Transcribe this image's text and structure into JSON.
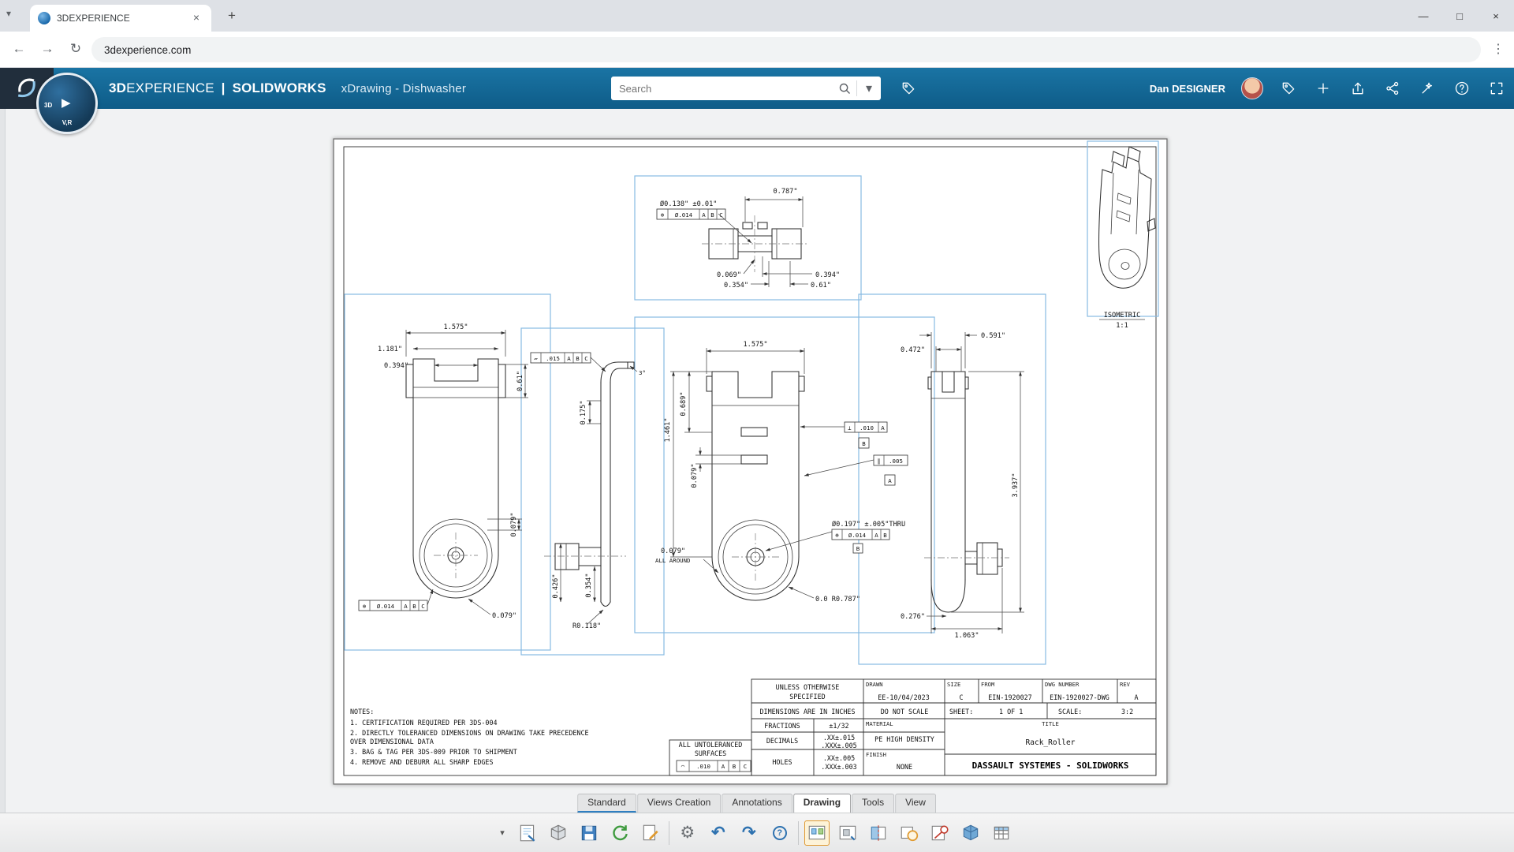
{
  "browser": {
    "tab_title": "3DEXPERIENCE",
    "url": "3dexperience.com",
    "controls": {
      "tab_search": "▾",
      "close_tab": "×",
      "new_tab": "+",
      "minimize": "—",
      "maximize": "□",
      "close": "×"
    },
    "nav": {
      "back": "←",
      "forward": "→",
      "reload": "↻",
      "menu": "⋮"
    }
  },
  "header": {
    "brand_3d": "3D",
    "brand_experience": "EXPERIENCE",
    "brand_divider": "|",
    "brand_app": "SOLIDWORKS",
    "doc_title": "xDrawing - Dishwasher",
    "search_placeholder": "Search",
    "search_chevron": "▾",
    "user_name": "Dan DESIGNER",
    "icon_names": [
      "search-icon",
      "search-dropdown-chevron",
      "bookmark-tag-icon",
      "tag-icon",
      "add-icon",
      "share-icon",
      "collaboration-icon",
      "assistant-icon",
      "help-icon",
      "fullscreen-icon"
    ]
  },
  "compass": {
    "top": "3D",
    "play": "▶",
    "bottom": "V,R"
  },
  "ribbon": {
    "tabs": [
      "Standard",
      "Views Creation",
      "Annotations",
      "Drawing",
      "Tools",
      "View"
    ],
    "active_tab": "Drawing"
  },
  "toolbar": {
    "chevron": "▾",
    "gear": "⚙",
    "undo": "↶",
    "redo": "↷",
    "help": "?",
    "icon_names": [
      "overflow-chevron",
      "drawing-sheet-icon",
      "view-orientation-icon",
      "save-icon",
      "update-icon",
      "sheet-format-icon",
      "options-gear-icon",
      "undo-icon",
      "redo-icon",
      "help-icon",
      "standard-view-tool-icon",
      "model-view-icon",
      "projected-view-icon",
      "section-view-icon",
      "annotation-note-icon",
      "isometric-cube-icon",
      "bom-table-icon"
    ]
  },
  "sheet": {
    "iso": {
      "label": "ISOMETRIC",
      "scale": "1:1"
    },
    "notes": {
      "title": "NOTES:",
      "lines": [
        "1. CERTIFICATION REQUIRED PER 3DS-004",
        "2. DIRECTLY TOLERANCED DIMENSIONS ON DRAWING TAKE PRECEDENCE",
        "OVER DIMENSIONAL DATA",
        "3. BAG & TAG PER 3DS-009 PRIOR TO SHIPMENT",
        "4. REMOVE AND DEBURR ALL SHARP EDGES"
      ]
    },
    "dims": {
      "tv_w": "0.787\"",
      "tv_dia": "Ø0.138\" ±0.01\"",
      "tv_d1": "0.069\"",
      "tv_d2": "0.394\"",
      "tv_d3": "0.354\"",
      "tv_d4": "0.61\"",
      "lv_w": "1.575\"",
      "lv_d1": "1.181\"",
      "lv_d2": "0.394\"",
      "lv_d3": "0.61\"",
      "lv_d4": "0.079\"",
      "lv_d5": "0.079\"",
      "pv_d1": "0.175\"",
      "pv_angle": "3°",
      "pv_d2": "0.426\"",
      "pv_d3": "0.354\"",
      "pv_d4": "R0.118\"",
      "cv_w": "1.575\"",
      "cv_d1": "1.461\"",
      "cv_d2": "0.689\"",
      "cv_d3": "0.079\"",
      "cv_hole": "Ø0.197\" ±.005\"THRU",
      "cv_aa1": "0.079\"",
      "cv_aa2": "ALL AROUND",
      "cv_r": "0.0 R0.787\"",
      "rv_d1": "0.591\"",
      "rv_d2": "0.472\"",
      "rv_d3": "3.937\"",
      "rv_d4": "0.276\"",
      "rv_d5": "1.063\""
    },
    "fcf": {
      "tv": {
        "sym": "⊕",
        "val": "Ø.014",
        "a": "A",
        "b": "B",
        "c": "C"
      },
      "lv": {
        "sym": "⊕",
        "val": "Ø.014",
        "a": "A",
        "b": "B",
        "c": "C"
      },
      "pv": {
        "sym": "▱",
        "val": ".015",
        "a": "A",
        "b": "B",
        "c": "C"
      },
      "cv_perp": {
        "sym": "⊥",
        "val": ".010",
        "a": "A"
      },
      "cv_par": {
        "sym": "∥",
        "val": ".005"
      },
      "cv_pos": {
        "sym": "⊕",
        "val": "Ø.014",
        "a": "A",
        "b": "B"
      },
      "tb": {
        "sym": "◠",
        "val": ".010",
        "a": "A",
        "b": "B",
        "c": "C"
      },
      "datum_b": "B",
      "datum_a": "A",
      "datum_b2": "B"
    },
    "title_block": {
      "unless1": "UNLESS OTHERWISE",
      "unless2": "SPECIFIED",
      "drawn_label": "DRAWN",
      "drawn_value": "EE-10/04/2023",
      "size_label": "SIZE",
      "size_value": "C",
      "from_label": "FROM",
      "from_value": "EIN-1920027",
      "dwg_label": "DWG NUMBER",
      "dwg_value": "EIN-1920027-DWG",
      "rev_label": "REV",
      "rev_value": "A",
      "dims_inches": "DIMENSIONS ARE IN INCHES",
      "do_not_scale": "DO NOT SCALE",
      "sheet_label": "SHEET:",
      "sheet_value": "1 OF 1",
      "scale_label": "SCALE:",
      "scale_value": "3:2",
      "fractions_label": "FRACTIONS",
      "fractions_value": "±1/32",
      "decimals_label": "DECIMALS",
      "decimals_value1": ".XX±.015",
      "decimals_value2": ".XXX±.005",
      "holes_label": "HOLES",
      "holes_value1": ".XX±.005",
      "holes_value2": ".XXX±.003",
      "material_label": "MATERIAL",
      "material_value": "PE HIGH DENSITY",
      "finish_label": "FINISH",
      "finish_value": "NONE",
      "title_label": "TITLE",
      "title_value": "Rack_Roller",
      "surfaces1": "ALL UNTOLERANCED",
      "surfaces2": "SURFACES",
      "company": "DASSAULT SYSTEMES - SOLIDWORKS"
    }
  }
}
